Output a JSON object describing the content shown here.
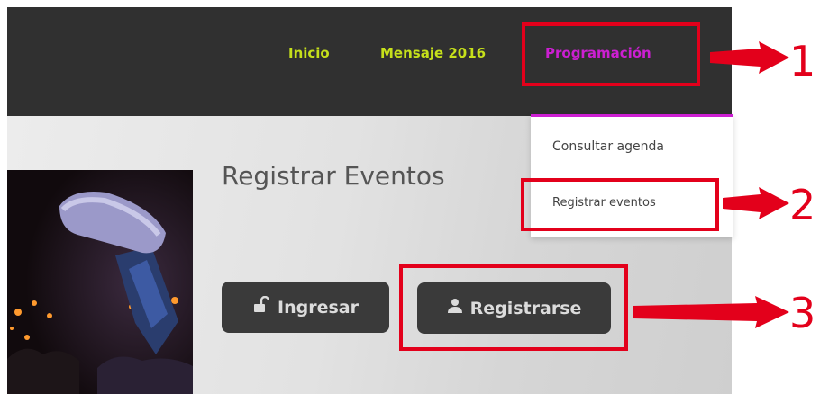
{
  "nav": {
    "items": [
      "Inicio",
      "Mensaje 2016",
      "Programación"
    ],
    "active": "Programación"
  },
  "page": {
    "title": "Registrar Eventos"
  },
  "buttons": {
    "login": "Ingresar",
    "register": "Registrarse"
  },
  "dropdown": {
    "items": [
      "Consultar agenda",
      "Registrar eventos"
    ]
  },
  "annotations": {
    "labels": [
      "1",
      "2",
      "3"
    ]
  },
  "colors": {
    "header_bg": "#303030",
    "nav_text": "#c6e01b",
    "nav_active": "#cc1fd2",
    "button_bg": "#3a3a3a",
    "annotation_red": "#e3001b"
  },
  "icons": {
    "login_icon": "unlock-icon",
    "register_icon": "user-icon"
  }
}
